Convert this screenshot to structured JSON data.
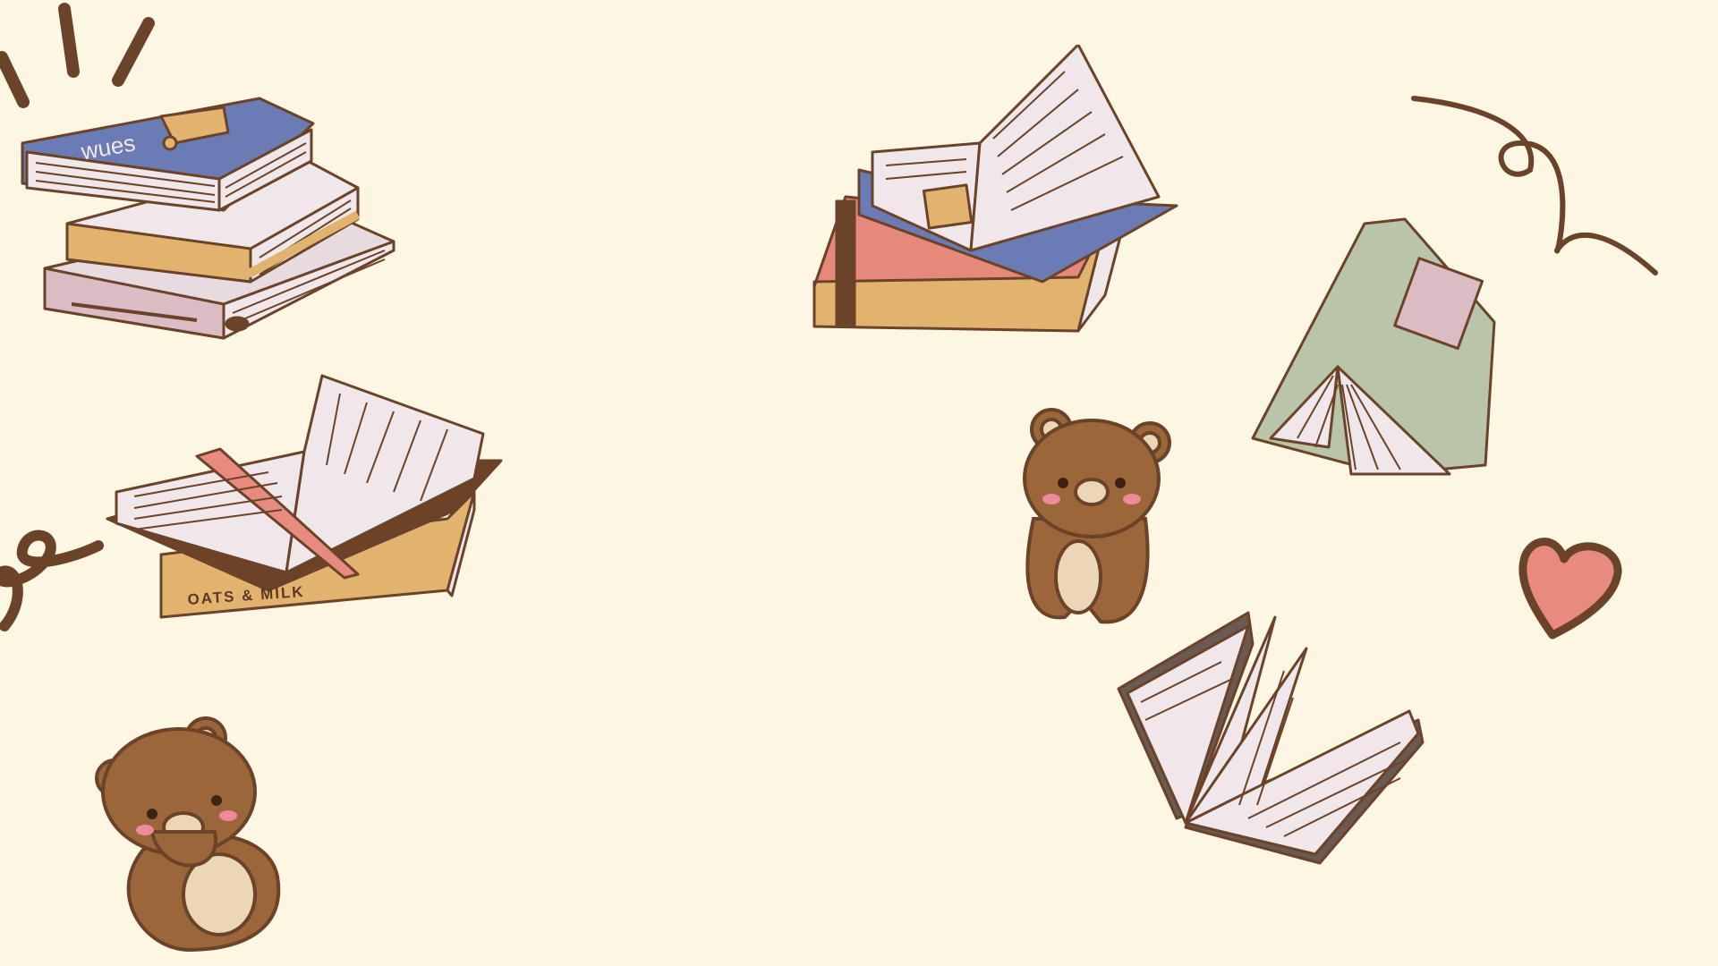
{
  "palette": {
    "background": "#fdf6e3",
    "outline": "#6b4328",
    "bear": "#9b6639",
    "bear_belly": "#ebd6b8",
    "blush": "#ef8a9a",
    "blue_cover": "#6b7bb3",
    "tan_cover": "#e2b36f",
    "pink_cover": "#dcbcc4",
    "salmon_cover": "#e7897a",
    "sage_cover": "#b9c4a8",
    "page": "#efe7e9",
    "heart": "#e68b7d"
  },
  "book_labels": {
    "stack_cover": "wues",
    "oats_spine": "OATS & MILK"
  },
  "decorations": [
    {
      "name": "burst-lines-icon"
    },
    {
      "name": "book-stack-illustration"
    },
    {
      "name": "open-book-bookmark-illustration"
    },
    {
      "name": "swirl-left-icon"
    },
    {
      "name": "bear-sitting-illustration"
    },
    {
      "name": "open-book-stack-illustration"
    },
    {
      "name": "bear-standing-illustration"
    },
    {
      "name": "swirl-right-icon"
    },
    {
      "name": "tented-book-illustration"
    },
    {
      "name": "heart-icon"
    },
    {
      "name": "flipping-book-illustration"
    }
  ]
}
